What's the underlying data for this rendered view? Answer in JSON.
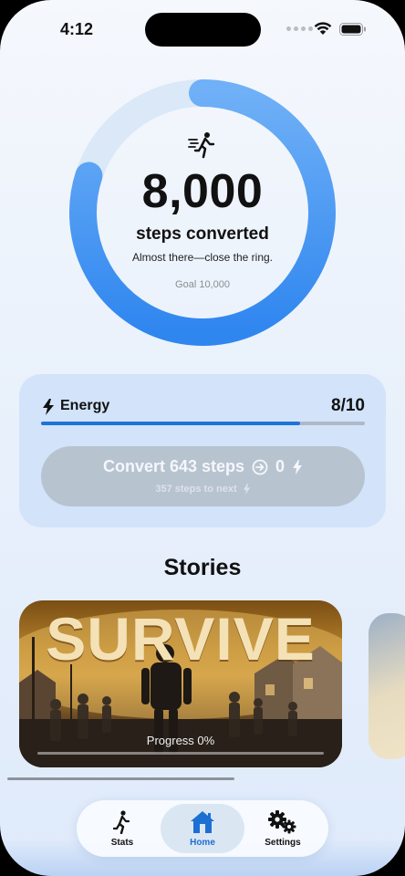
{
  "status_bar": {
    "time": "4:12",
    "icons": [
      "cellular-dots-icon",
      "wifi-icon",
      "battery-icon"
    ]
  },
  "ring": {
    "icon": "walker-speed-icon",
    "steps_value": "8,000",
    "steps_label": "steps converted",
    "subtitle": "Almost there—close the ring.",
    "goal_text": "Goal 10,000",
    "progress_fraction": 0.8,
    "colors": {
      "progress": "#3b8ef0",
      "progress_start": "#1f7be8",
      "track": "#d9e7f8"
    }
  },
  "energy": {
    "label": "Energy",
    "value_text": "8/10",
    "fraction": 0.8,
    "convert_label": "Convert 643 steps",
    "convert_value": "0",
    "convert_sub": "357 steps to next",
    "colors": {
      "bar": "#1e74d6",
      "button": "#b8c3d0"
    }
  },
  "stories": {
    "title": "Stories",
    "cards": [
      {
        "title": "SURVIVE",
        "progress_label": "Progress 0%",
        "progress_fraction": 0
      }
    ]
  },
  "tab_bar": {
    "tabs": [
      {
        "label": "Stats",
        "icon": "walking-person-icon",
        "active": false
      },
      {
        "label": "Home",
        "icon": "house-icon",
        "active": true
      },
      {
        "label": "Settings",
        "icon": "gears-icon",
        "active": false
      }
    ],
    "accent": "#1c6fd3"
  }
}
